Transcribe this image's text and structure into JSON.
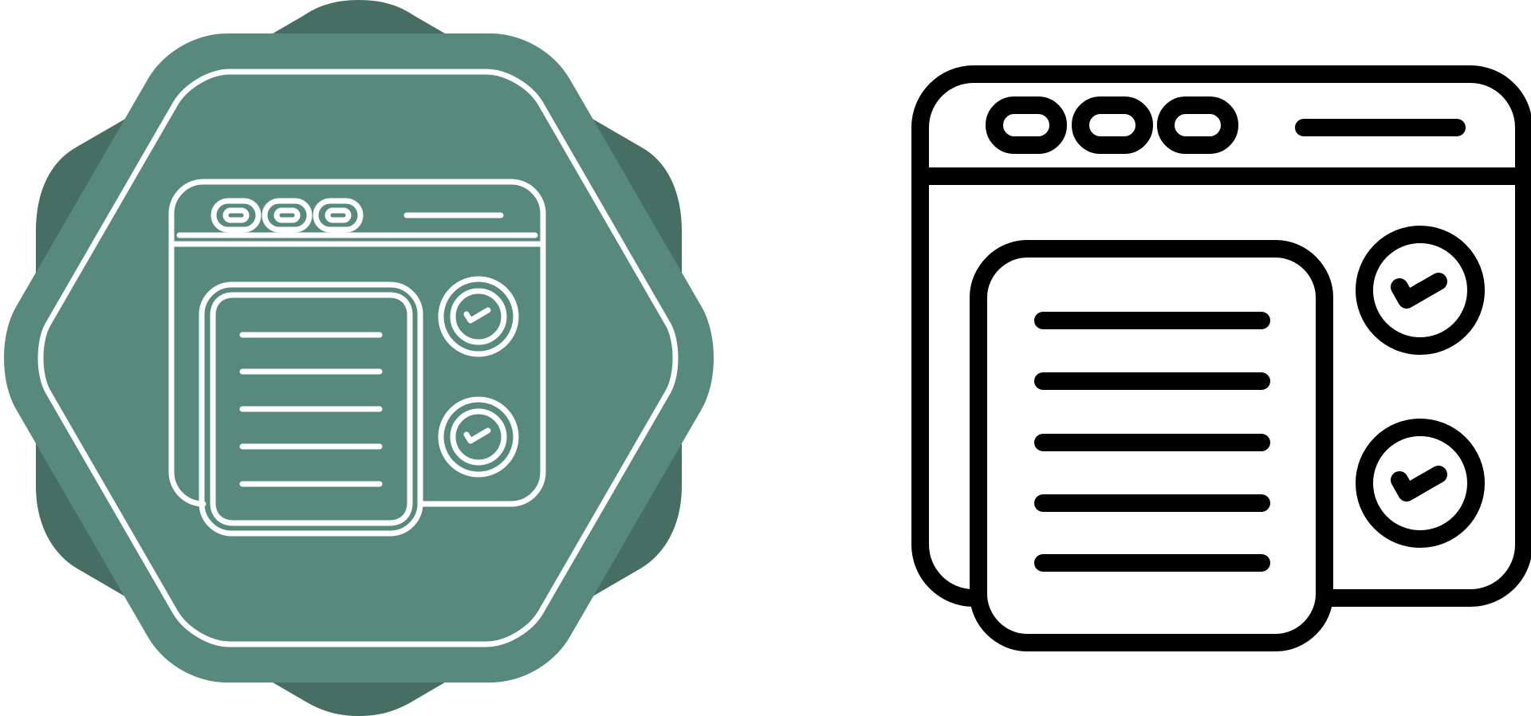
{
  "icons": [
    {
      "name": "browser-checklist-icon",
      "variant": "badge",
      "background_color": "#578a7c",
      "shadow_color": "#466e62",
      "stroke_color": "#ffffff"
    },
    {
      "name": "browser-checklist-icon",
      "variant": "outline",
      "stroke_color": "#000000",
      "fill_color": "#ffffff"
    }
  ]
}
